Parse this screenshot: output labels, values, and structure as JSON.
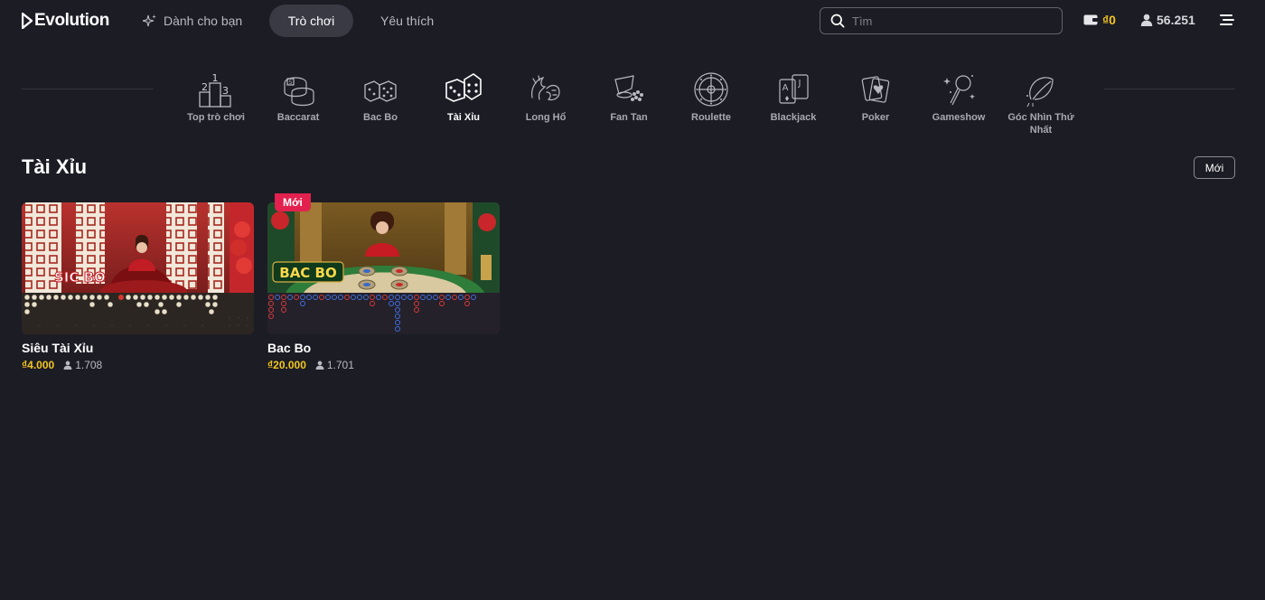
{
  "header": {
    "logo_text": "Evolution",
    "nav": {
      "for_you": "Dành cho bạn",
      "games": "Trò chơi",
      "favorites": "Yêu thích"
    },
    "search_placeholder": "Tìm",
    "wallet_balance": "₫0",
    "online_players": "56.251",
    "icons": {
      "sparkle": "sparkle-icon",
      "search": "search-icon",
      "wallet": "wallet-icon",
      "user": "user-icon",
      "menu": "menu-icon"
    }
  },
  "categories": [
    {
      "label": "Top trò chơi",
      "icon": "podium-icon",
      "active": false
    },
    {
      "label": "Baccarat",
      "icon": "baccarat-icon",
      "active": false
    },
    {
      "label": "Bac Bo",
      "icon": "dice-icon",
      "active": false
    },
    {
      "label": "Tài Xỉu",
      "icon": "dice-icon",
      "active": true
    },
    {
      "label": "Long Hổ",
      "icon": "dragon-tiger-icon",
      "active": false
    },
    {
      "label": "Fan Tan",
      "icon": "fan-tan-icon",
      "active": false
    },
    {
      "label": "Roulette",
      "icon": "roulette-icon",
      "active": false
    },
    {
      "label": "Blackjack",
      "icon": "cards-icon",
      "active": false
    },
    {
      "label": "Poker",
      "icon": "poker-icon",
      "active": false
    },
    {
      "label": "Gameshow",
      "icon": "microphone-icon",
      "active": false
    },
    {
      "label": "Góc Nhìn Thứ Nhất",
      "icon": "first-person-icon",
      "active": false
    }
  ],
  "section": {
    "title": "Tài Xỉu",
    "sort_label": "Mới"
  },
  "games": [
    {
      "title": "Siêu Tài Xỉu",
      "min_bet": "₫4.000",
      "players": "1.708",
      "badge": ""
    },
    {
      "title": "Bac Bo",
      "min_bet": "₫20.000",
      "players": "1.701",
      "badge": "Mới",
      "logo_text": "BAC BO"
    }
  ],
  "colors": {
    "background": "#1c1c24",
    "accent_gold": "#f2c51f",
    "badge_red": "#e2214f",
    "active_pill": "#3a3a44"
  }
}
